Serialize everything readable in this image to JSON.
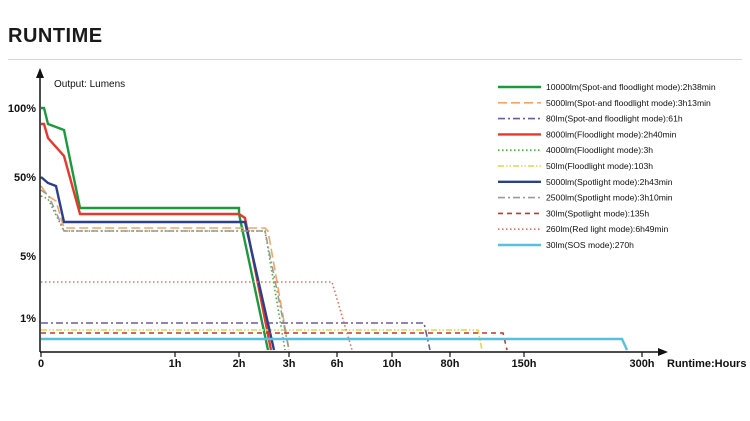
{
  "header": {
    "title": "RUNTIME"
  },
  "chart_data": {
    "type": "line",
    "output_label": "Output: Lumens",
    "x_axis_title": "Runtime:Hours",
    "y_tick_labels": [
      "100%",
      "50%",
      "5%",
      "1%"
    ],
    "x_tick_labels": [
      "0",
      "1h",
      "2h",
      "3h",
      "6h",
      "10h",
      "80h",
      "150h",
      "300h"
    ],
    "scale_note": "Non-linear (broken) axes",
    "legend_position": "top-right",
    "grid": false,
    "series": [
      {
        "name": "10000lm(Spot-and floodlight mode):2h38min",
        "color": "#1a9a3c",
        "dash": "solid",
        "points": [
          [
            "0",
            100
          ],
          [
            "0.05h",
            100
          ],
          [
            "0.1h",
            85
          ],
          [
            "0.3h",
            65
          ],
          [
            "0.5h",
            25
          ],
          [
            "2h",
            25
          ],
          [
            "2h",
            21
          ],
          [
            "2.6h",
            0
          ]
        ]
      },
      {
        "name": "5000lm(Spot-and floodlight mode):3h13min",
        "color": "#f4a466",
        "dash": "long-dash",
        "points": [
          [
            "0",
            45
          ],
          [
            "0.1h",
            40
          ],
          [
            "0.2h",
            32
          ],
          [
            "0.3h",
            13
          ],
          [
            "2.5h",
            13
          ],
          [
            "2.6h",
            12
          ],
          [
            "3.2h",
            0
          ]
        ]
      },
      {
        "name": "80lm(Spot-and floodlight mode):61h",
        "color": "#6b5b9e",
        "dash": "dash-dot",
        "points": [
          [
            "0",
            1
          ],
          [
            "60h",
            1
          ],
          [
            "61h",
            0
          ]
        ]
      },
      {
        "name": "8000lm(Floodlight mode):2h40min",
        "color": "#e8372b",
        "dash": "solid",
        "points": [
          [
            "0",
            85
          ],
          [
            "0.05h",
            85
          ],
          [
            "0.1h",
            72
          ],
          [
            "0.3h",
            52
          ],
          [
            "0.5h",
            21
          ],
          [
            "2h",
            21
          ],
          [
            "2.1h",
            20
          ],
          [
            "2.7h",
            0
          ]
        ]
      },
      {
        "name": "4000lm(Floodlight mode):3h",
        "color": "#4daa3e",
        "dash": "dotted",
        "points": [
          [
            "0",
            40
          ],
          [
            "0.1h",
            34
          ],
          [
            "0.2h",
            28
          ],
          [
            "0.3h",
            12
          ],
          [
            "2.5h",
            12
          ],
          [
            "3h",
            0
          ]
        ]
      },
      {
        "name": "50lm(Floodlight mode):103h",
        "color": "#e6d44a",
        "dash": "dash-dot-dot",
        "points": [
          [
            "0",
            0.7
          ],
          [
            "103h",
            0.7
          ],
          [
            "104h",
            0
          ]
        ]
      },
      {
        "name": "5000lm(Spotlight mode):2h43min",
        "color": "#2b3f8f",
        "dash": "solid",
        "points": [
          [
            "0",
            50
          ],
          [
            "0.1h",
            47
          ],
          [
            "0.2h",
            45
          ],
          [
            "0.3h",
            16
          ],
          [
            "2.1h",
            16
          ],
          [
            "2.8h",
            0
          ]
        ]
      },
      {
        "name": "2500lm(Spotlight mode):3h10min",
        "color": "#9a9a9a",
        "dash": "dash-dot",
        "points": [
          [
            "0",
            44
          ],
          [
            "0.1h",
            38
          ],
          [
            "0.2h",
            30
          ],
          [
            "0.3h",
            12
          ],
          [
            "2.5h",
            12
          ],
          [
            "3.2h",
            0
          ]
        ]
      },
      {
        "name": "30lm(Spotlight mode):135h",
        "color": "#c0392b",
        "dash": "dashed",
        "points": [
          [
            "0",
            0.6
          ],
          [
            "135h",
            0.6
          ],
          [
            "136h",
            0
          ]
        ]
      },
      {
        "name": "260lm(Red light mode):6h49min",
        "color": "#f06a5a",
        "dash": "dotted",
        "points": [
          [
            "0",
            2.2
          ],
          [
            "6h",
            2.2
          ],
          [
            "6.8h",
            0
          ]
        ]
      },
      {
        "name": "30lm(SOS mode):270h",
        "color": "#58c0de",
        "dash": "solid",
        "points": [
          [
            "0",
            0.5
          ],
          [
            "270h",
            0.5
          ],
          [
            "275h",
            0
          ]
        ]
      }
    ]
  }
}
